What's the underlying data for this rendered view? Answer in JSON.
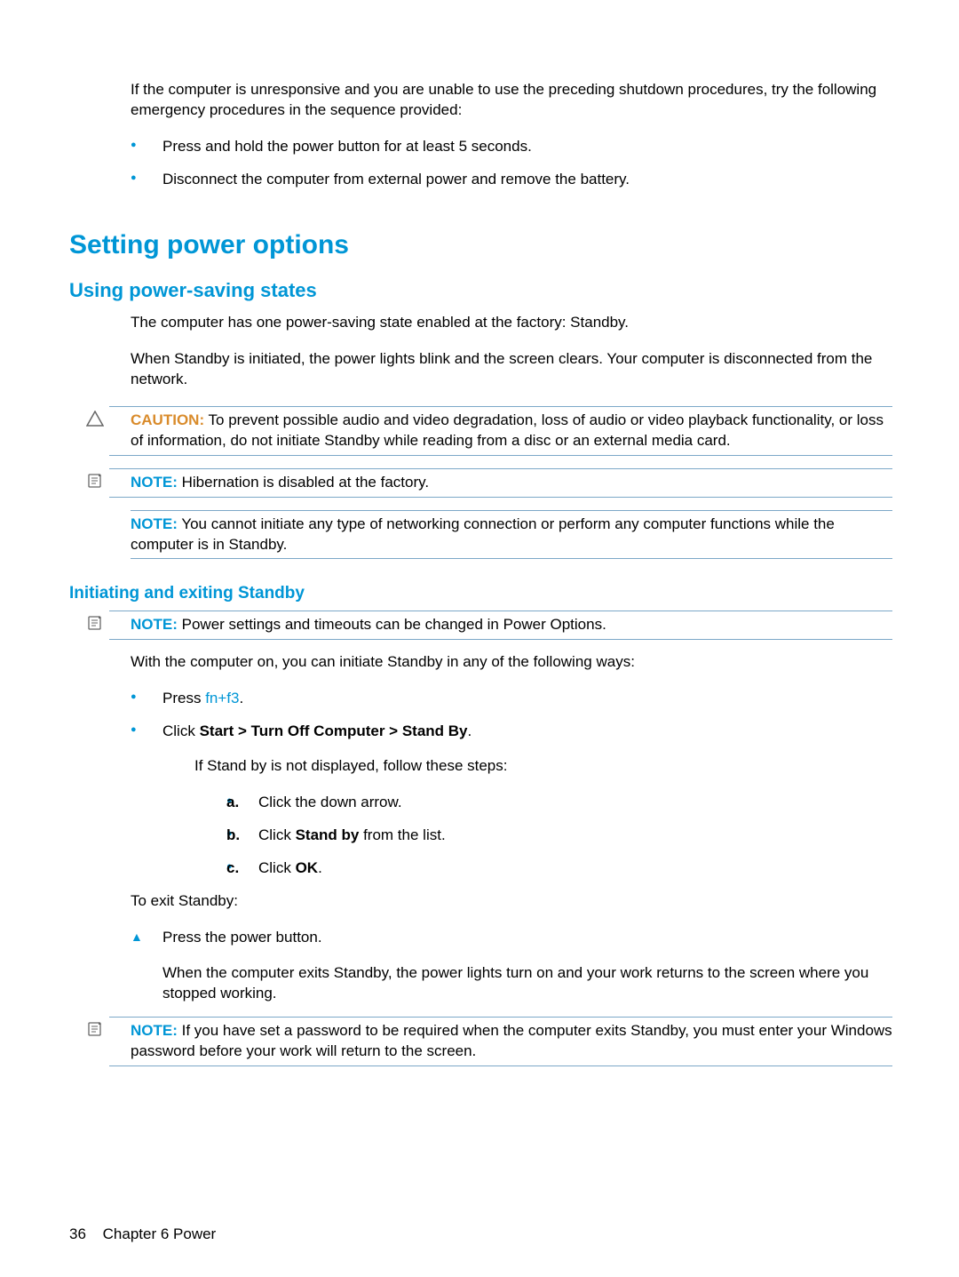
{
  "intro": {
    "p1": "If the computer is unresponsive and you are unable to use the preceding shutdown procedures, try the following emergency procedures in the sequence provided:",
    "bullets": [
      "Press and hold the power button for at least 5 seconds.",
      "Disconnect the computer from external power and remove the battery."
    ]
  },
  "h1": "Setting power options",
  "section1": {
    "h2": "Using power-saving states",
    "p1": "The computer has one power-saving state enabled at the factory: Standby.",
    "p2": "When Standby is initiated, the power lights blink and the screen clears. Your computer is disconnected from the network.",
    "caution": {
      "label": "CAUTION:",
      "text": "To prevent possible audio and video degradation, loss of audio or video playback functionality, or loss of information, do not initiate Standby while reading from a disc or an external media card."
    },
    "note1": {
      "label": "NOTE:",
      "text": "Hibernation is disabled at the factory."
    },
    "note2": {
      "label": "NOTE:",
      "text": "You cannot initiate any type of networking connection or perform any computer functions while the computer is in Standby."
    }
  },
  "section2": {
    "h3": "Initiating and exiting Standby",
    "note1": {
      "label": "NOTE:",
      "text": "Power settings and timeouts can be changed in Power Options."
    },
    "p1": "With the computer on, you can initiate Standby in any of the following ways:",
    "bullet1_pre": "Press ",
    "bullet1_link": "fn+f3",
    "bullet1_post": ".",
    "bullet2_pre": "Click ",
    "bullet2_bold": "Start > Turn Off Computer > Stand By",
    "bullet2_post": ".",
    "p2": "If Stand by is not displayed, follow these steps:",
    "steps": {
      "a_marker": "a.",
      "a": "Click the down arrow.",
      "b_marker": "b.",
      "b_pre": "Click ",
      "b_bold": "Stand by",
      "b_post": " from the list.",
      "c_marker": "c.",
      "c_pre": "Click ",
      "c_bold": "OK",
      "c_post": "."
    },
    "p3": "To exit Standby:",
    "triangle1": "Press the power button.",
    "triangle1_sub": "When the computer exits Standby, the power lights turn on and your work returns to the screen where you stopped working.",
    "note2": {
      "label": "NOTE:",
      "text": "If you have set a password to be required when the computer exits Standby, you must enter your Windows password before your work will return to the screen."
    }
  },
  "footer": {
    "page": "36",
    "chapter": "Chapter 6   Power"
  }
}
